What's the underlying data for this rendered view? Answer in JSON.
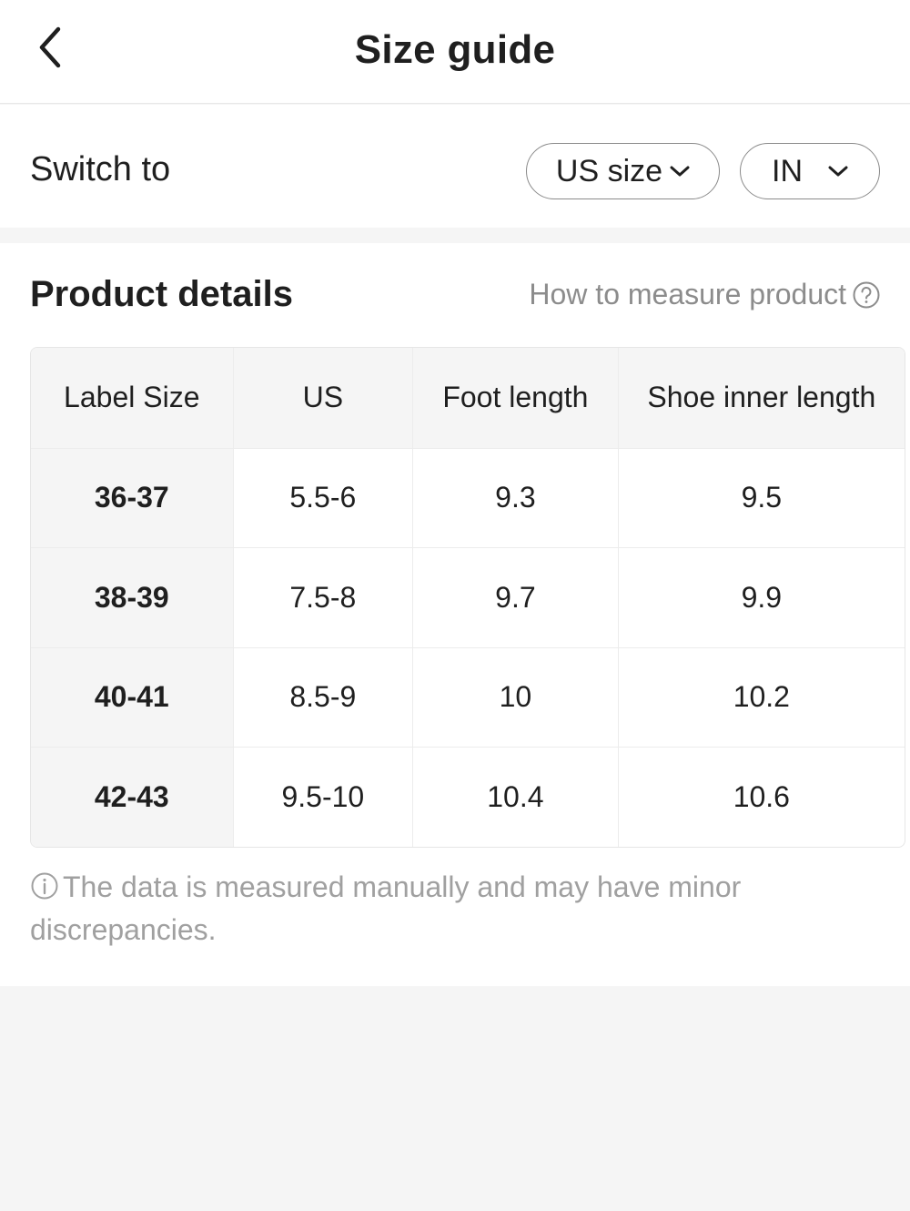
{
  "header": {
    "title": "Size guide"
  },
  "switch": {
    "label": "Switch to",
    "size_system": "US size",
    "unit": "IN"
  },
  "details": {
    "title": "Product details",
    "measure_link": "How to measure product"
  },
  "table": {
    "headers": [
      "Label Size",
      "US",
      "Foot length",
      "Shoe inner length"
    ],
    "rows": [
      [
        "36-37",
        "5.5-6",
        "9.3",
        "9.5"
      ],
      [
        "38-39",
        "7.5-8",
        "9.7",
        "9.9"
      ],
      [
        "40-41",
        "8.5-9",
        "10",
        "10.2"
      ],
      [
        "42-43",
        "9.5-10",
        "10.4",
        "10.6"
      ]
    ]
  },
  "note": {
    "text": "The data is measured manually and may have minor discrepancies."
  }
}
